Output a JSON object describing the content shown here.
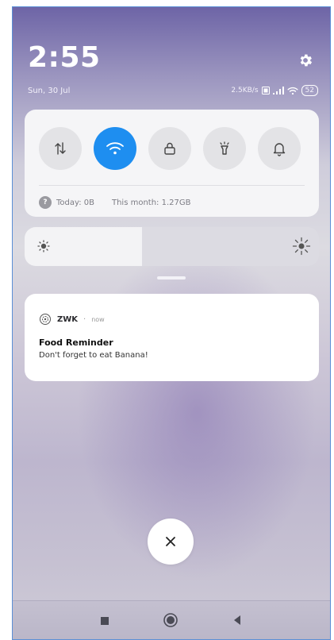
{
  "status_bar": {
    "time": "2:55",
    "date": "Sun, 30 Jul",
    "net_speed": "2.5KB/s",
    "battery": "52"
  },
  "quick_settings": {
    "tiles": [
      {
        "name": "mobile-data",
        "icon": "data-transfer-icon",
        "active": false
      },
      {
        "name": "wifi",
        "icon": "wifi-icon",
        "active": true
      },
      {
        "name": "lock",
        "icon": "lock-icon",
        "active": false
      },
      {
        "name": "flashlight",
        "icon": "flashlight-icon",
        "active": false
      },
      {
        "name": "bell",
        "icon": "bell-icon",
        "active": false
      }
    ],
    "data_today": "Today: 0B",
    "data_month": "This month: 1.27GB",
    "active_color": "#1e8ef0"
  },
  "brightness": {
    "level": 0.4
  },
  "notification": {
    "app_name": "ZWK",
    "time": "now",
    "title": "Food Reminder",
    "body": "Don't forget to eat Banana!"
  }
}
